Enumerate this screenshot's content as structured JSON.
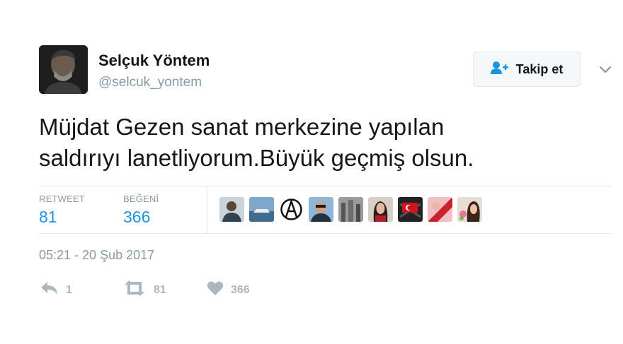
{
  "user": {
    "name": "Selçuk Yöntem",
    "handle": "@selcuk_yontem"
  },
  "follow_button": {
    "label": "Takip et"
  },
  "tweet": {
    "lines": [
      "Müjdat Gezen sanat merkezine yapılan",
      "saldırıyı lanetliyorum.Büyük geçmiş olsun."
    ]
  },
  "stats": {
    "retweet_label": "RETWEET",
    "retweet_count": "81",
    "like_label": "BEĞENİ",
    "like_count": "366"
  },
  "likers": [
    "liker-1",
    "liker-2",
    "liker-3",
    "liker-4",
    "liker-5",
    "liker-6",
    "liker-7",
    "liker-8",
    "liker-9"
  ],
  "timestamp": "05:21 - 20 Şub 2017",
  "actions": {
    "reply_count": "1",
    "retweet_count": "81",
    "like_count": "366"
  },
  "colors": {
    "link_blue": "#1c94e0",
    "muted": "#8899a6",
    "icon_muted": "#aab8c2",
    "border": "#e1e8ed"
  }
}
